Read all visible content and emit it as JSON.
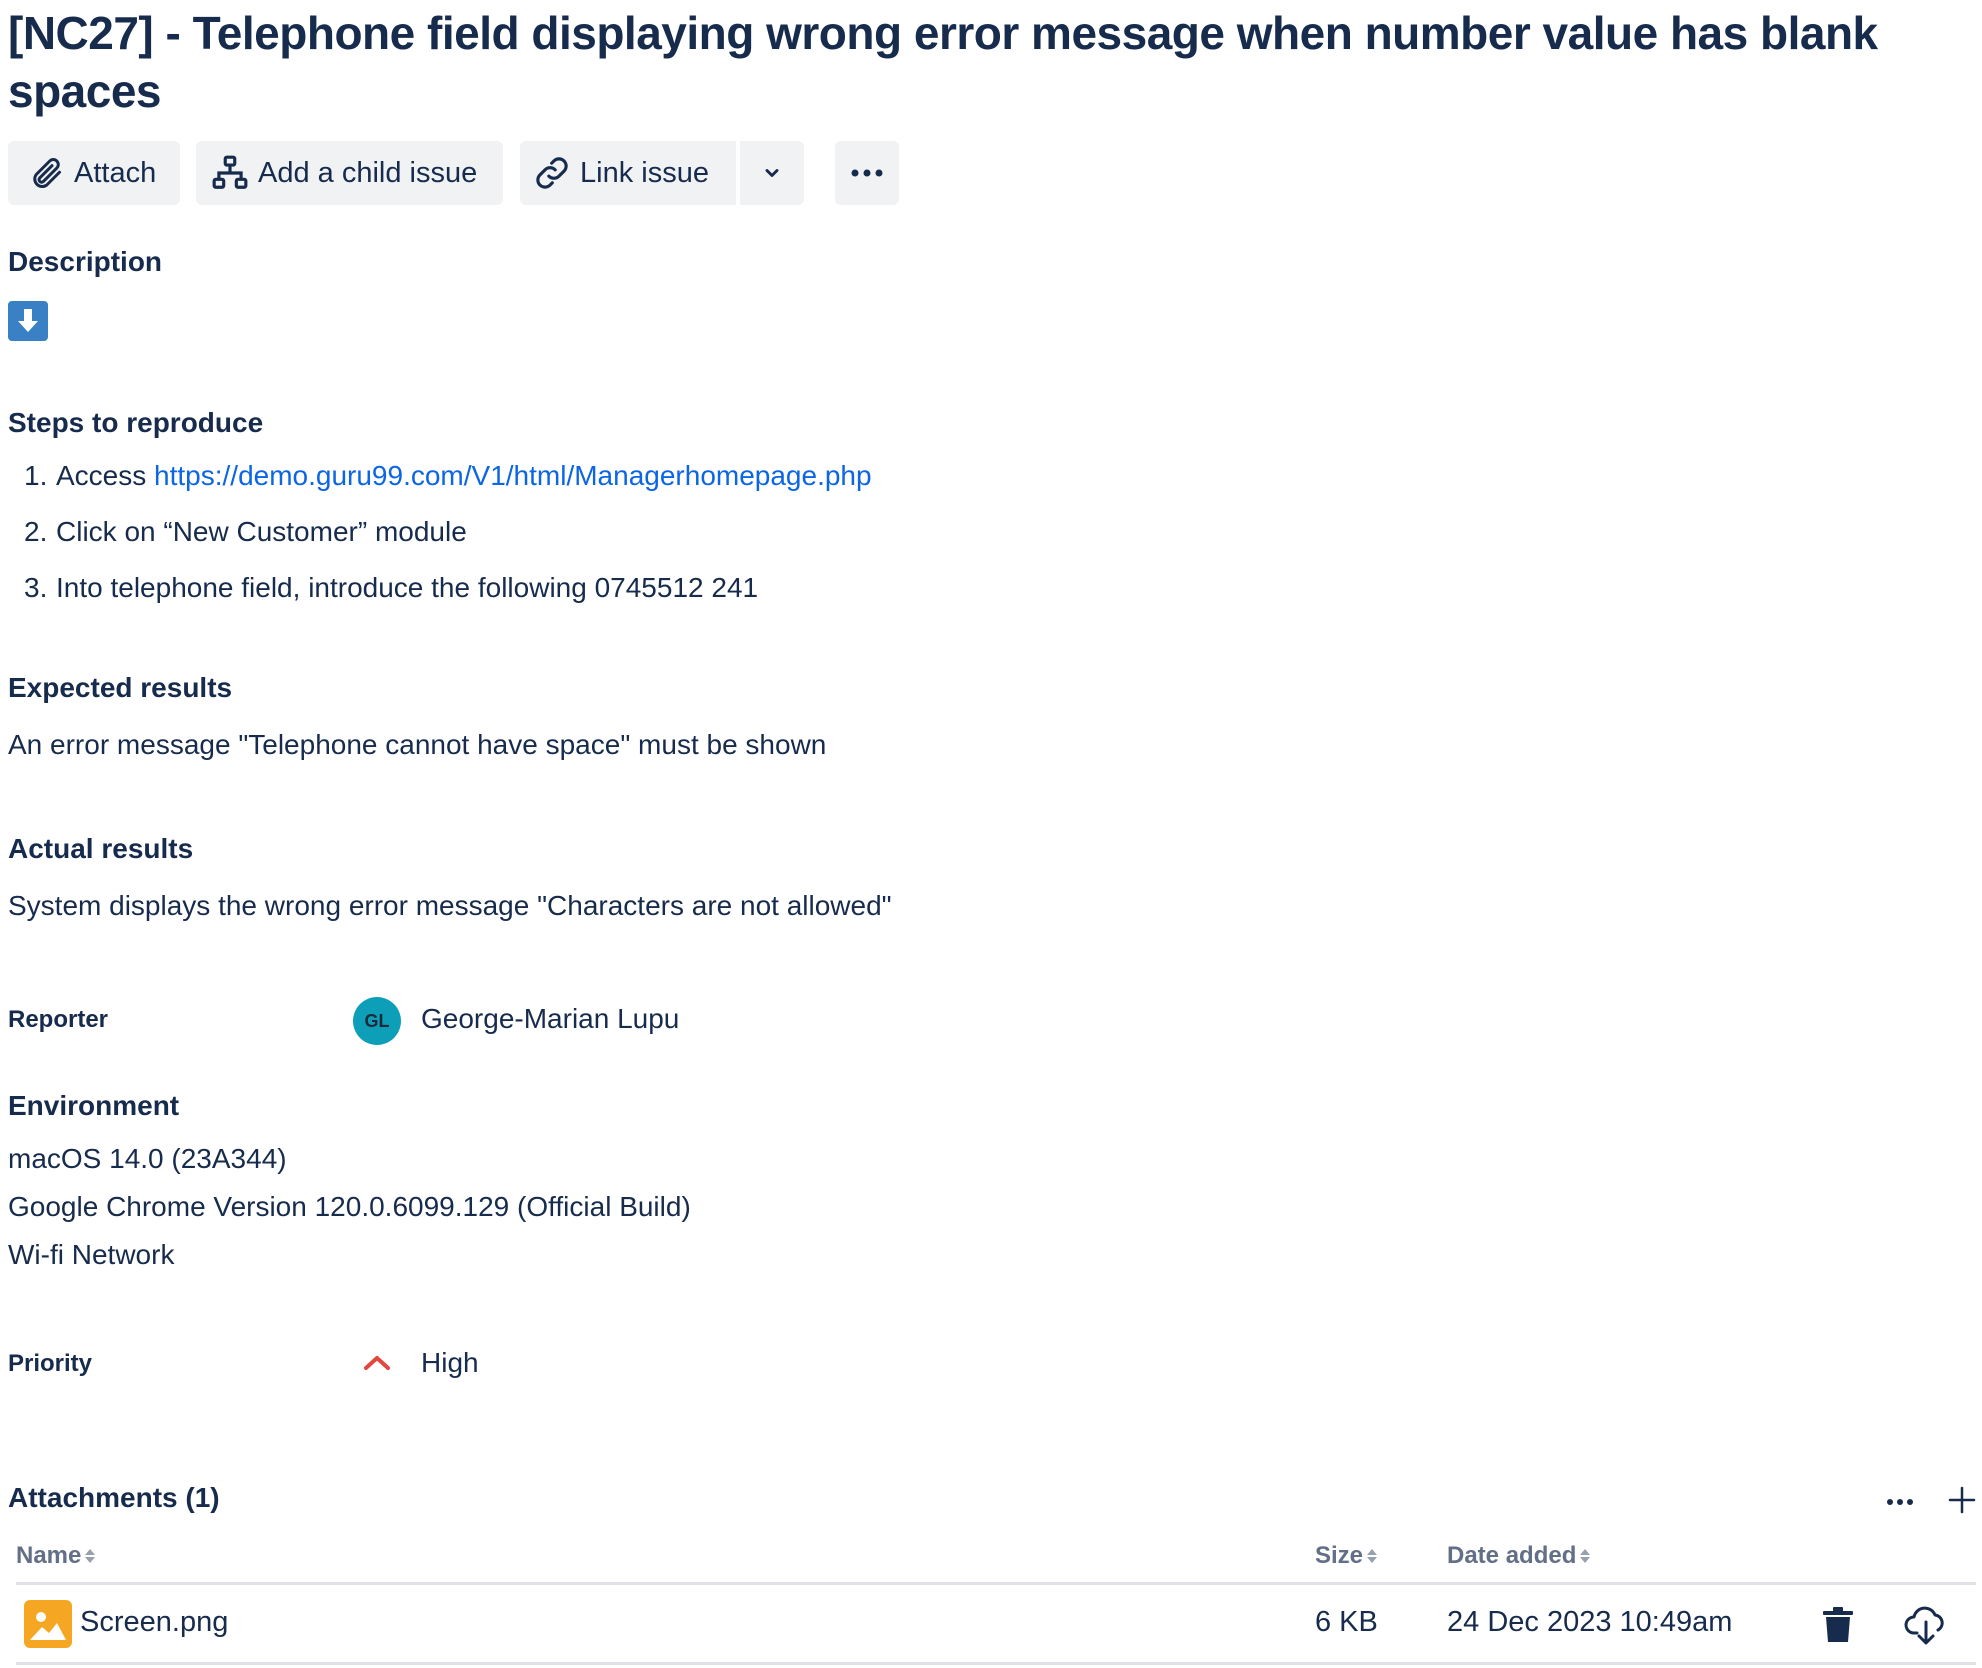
{
  "issue": {
    "title": "[NC27] - Telephone field displaying wrong error message when number value has blank spaces"
  },
  "toolbar": {
    "attach_label": "Attach",
    "add_child_label": "Add a child issue",
    "link_issue_label": "Link issue"
  },
  "description": {
    "heading": "Description",
    "steps_heading": "Steps to reproduce",
    "steps": [
      {
        "num": "1.",
        "prefix": "Access ",
        "link": "https://demo.guru99.com/V1/html/Managerhomepage.php"
      },
      {
        "num": "2.",
        "text": "Click on “New Customer” module"
      },
      {
        "num": "3.",
        "text": "Into telephone field, introduce the following 0745512 241"
      }
    ],
    "expected_heading": "Expected results",
    "expected_text": "An error message \"Telephone cannot have space\" must be shown",
    "actual_heading": "Actual results",
    "actual_text": "System displays the wrong error message \"Characters are not allowed\""
  },
  "reporter": {
    "label": "Reporter",
    "initials": "GL",
    "name": "George-Marian Lupu",
    "avatar_color": "#0e9fb8"
  },
  "environment": {
    "heading": "Environment",
    "lines": [
      "macOS 14.0 (23A344)",
      "Google Chrome Version 120.0.6099.129 (Official Build)",
      "Wi-fi Network"
    ]
  },
  "priority": {
    "label": "Priority",
    "value": "High",
    "icon": "priority-high-icon",
    "color": "#e2483d"
  },
  "attachments": {
    "heading": "Attachments (1)",
    "columns": {
      "name": "Name",
      "size": "Size",
      "date": "Date added"
    },
    "rows": [
      {
        "name": "Screen.png",
        "size": "6 KB",
        "date": "24 Dec 2023 10:49am",
        "icon": "image-file-icon"
      }
    ]
  },
  "colors": {
    "text": "#172b4d",
    "link": "#0c66e4",
    "button_bg": "#f1f2f4",
    "image_icon": "#f5a623",
    "info_icon": "#3a80c4"
  }
}
